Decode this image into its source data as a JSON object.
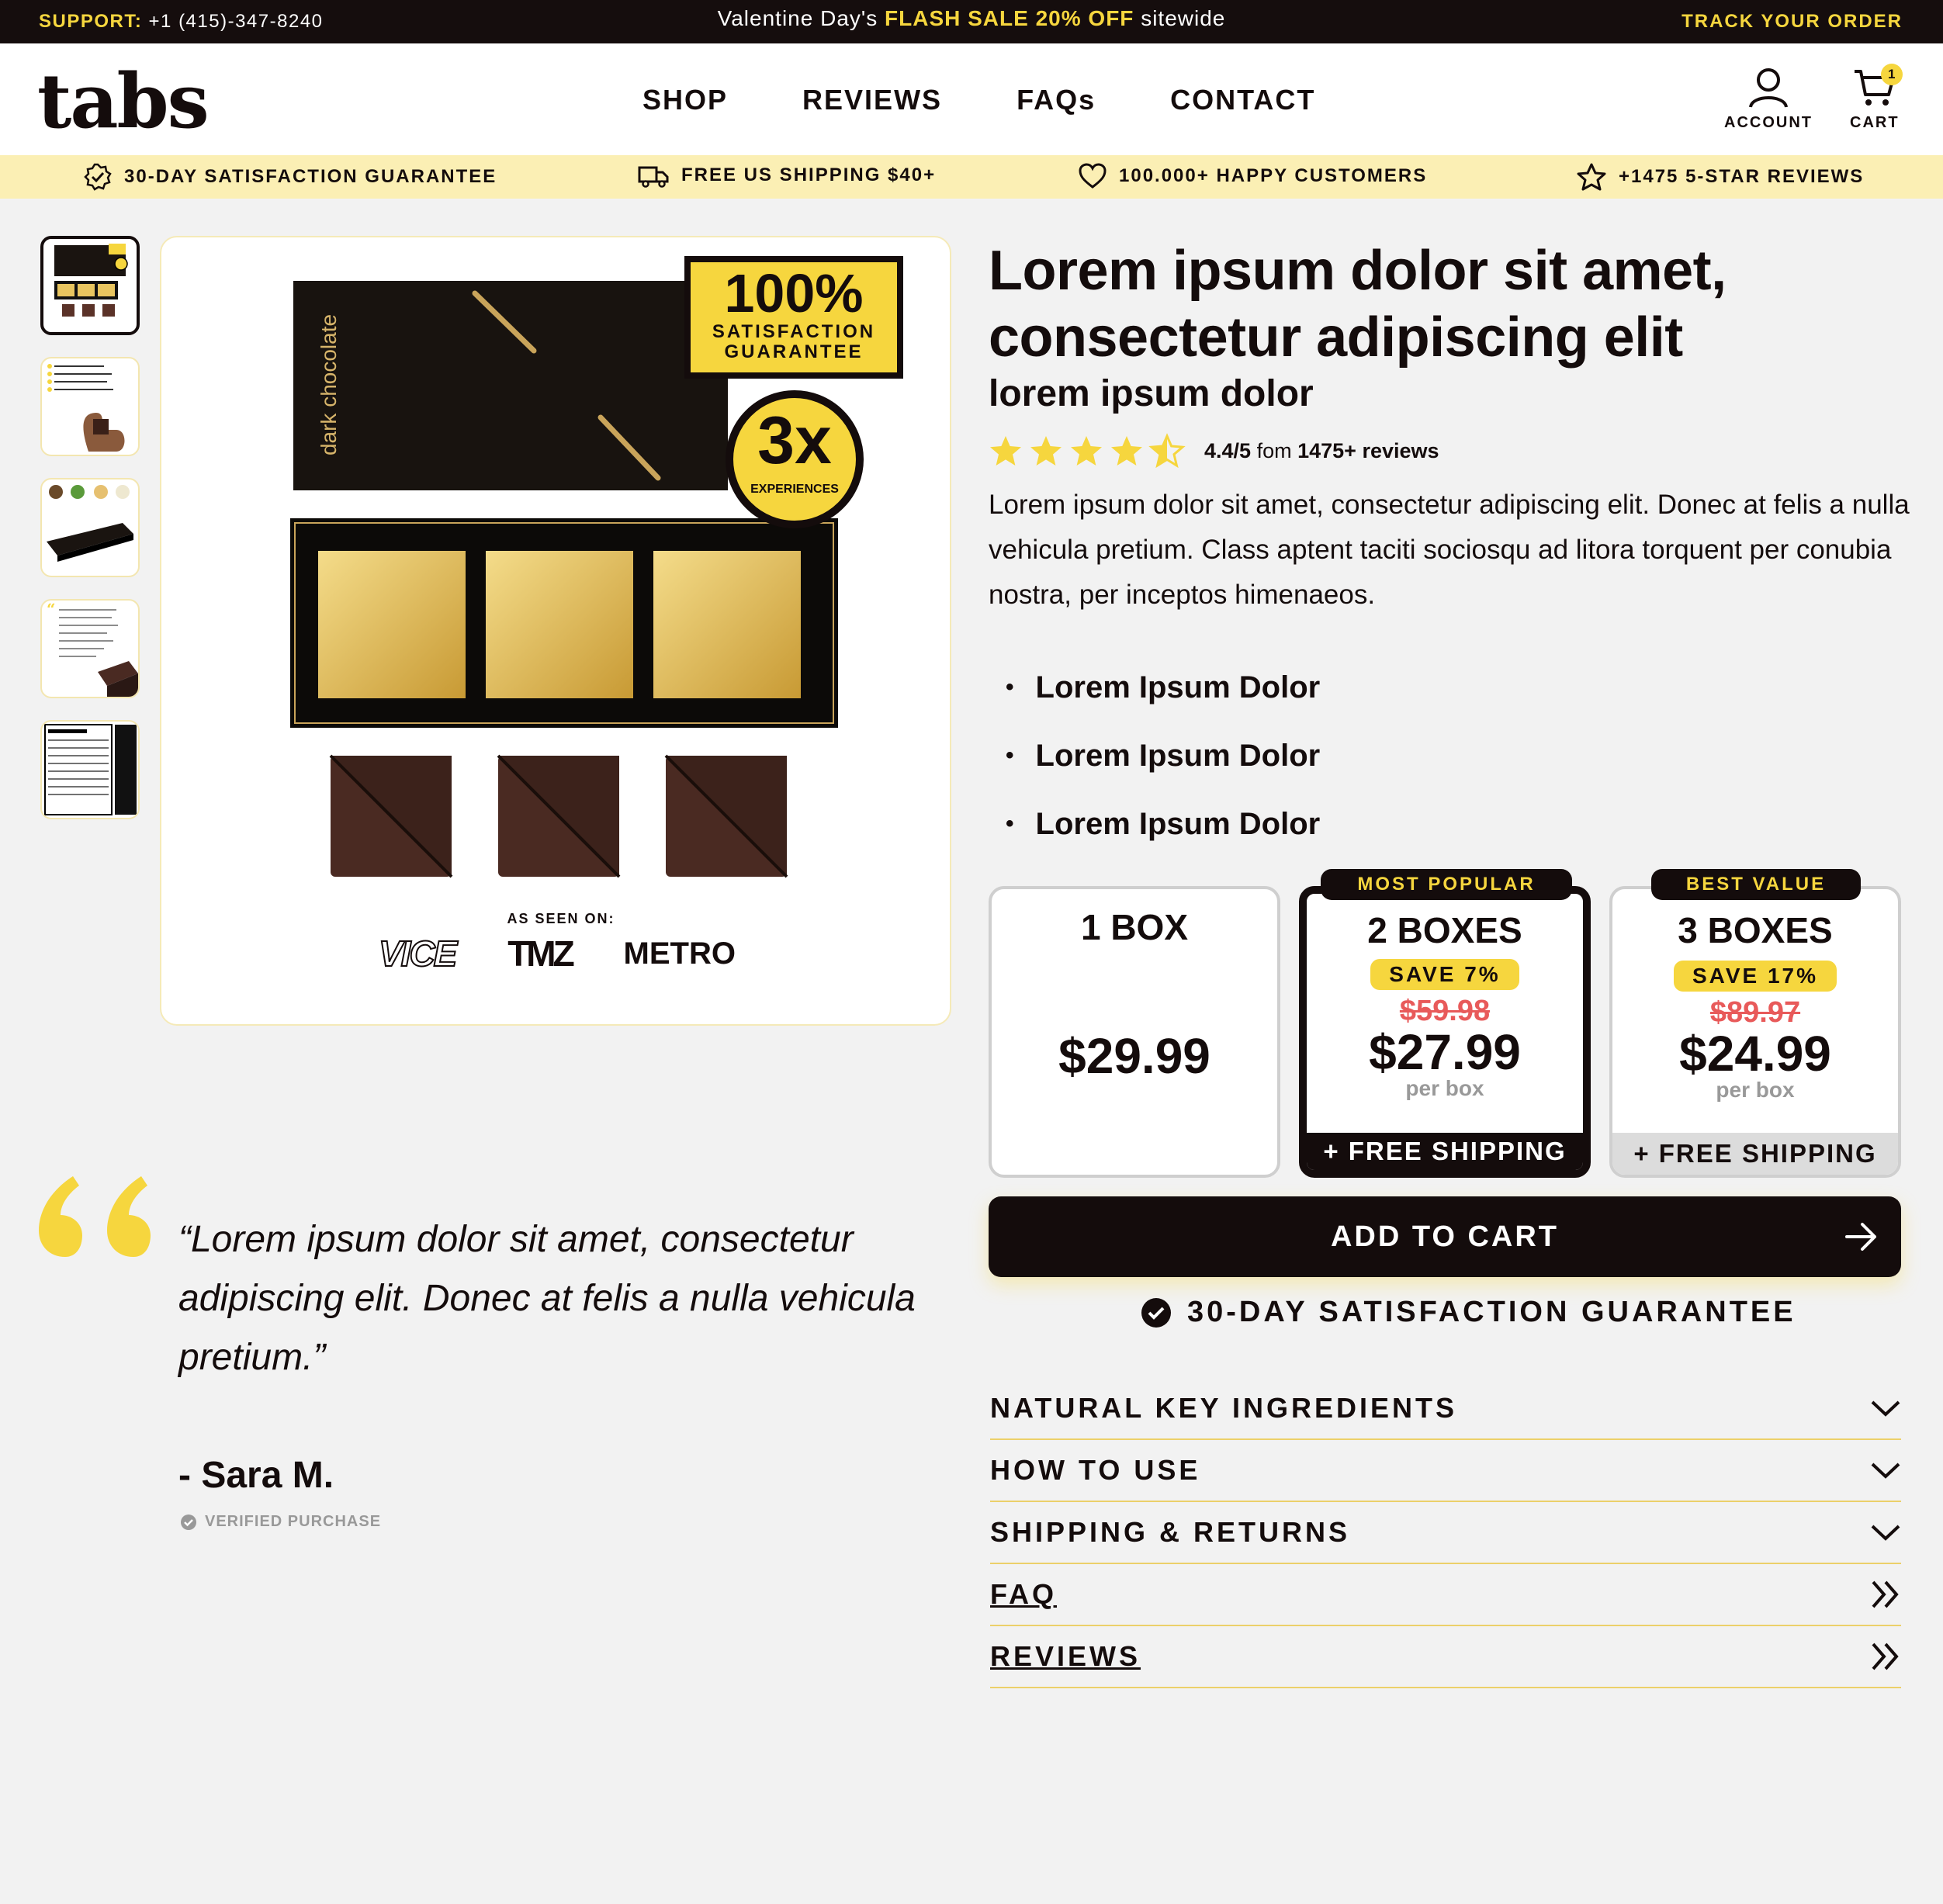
{
  "topbar": {
    "support_label": "SUPPORT:",
    "support_phone": "+1 (415)-347-8240",
    "promo_prefix": "Valentine Day's",
    "promo_highlight": "FLASH SALE 20% OFF",
    "promo_suffix": "sitewide",
    "track": "TRACK YOUR ORDER"
  },
  "header": {
    "logo": "tabs",
    "nav": [
      "SHOP",
      "REVIEWS",
      "FAQs",
      "CONTACT"
    ],
    "account_label": "ACCOUNT",
    "cart_label": "CART",
    "cart_count": "1"
  },
  "benefits": [
    {
      "icon": "badge-check-icon",
      "label": "30-DAY SATISFACTION GUARANTEE"
    },
    {
      "icon": "truck-icon",
      "label": "FREE US SHIPPING $40+"
    },
    {
      "icon": "heart-icon",
      "label": "100.000+ HAPPY CUSTOMERS"
    },
    {
      "icon": "star-outline-icon",
      "label": "+1475 5-STAR REVIEWS"
    }
  ],
  "gallery": {
    "thumbnails": [
      "product-box",
      "benefits-infographic",
      "ingredients",
      "customer-review",
      "nutrition-facts"
    ],
    "box_text": "dark chocolate",
    "badge_percent": "100%",
    "badge_line1": "SATISFACTION",
    "badge_line2": "GUARANTEE",
    "circle_big": "3x",
    "circle_small": "EXPERIENCES",
    "as_seen_on": "AS SEEN ON:",
    "press": [
      "VICE",
      "TMZ",
      "METRO"
    ]
  },
  "product": {
    "title": "Lorem ipsum dolor sit amet, consectetur adipiscing elit",
    "subtitle": "lorem ipsum dolor",
    "rating_value": 4.4,
    "rating_score": "4.4/5",
    "rating_from": "fom",
    "rating_count": "1475+ reviews",
    "description": "Lorem ipsum dolor sit amet, consectetur adipiscing elit. Donec at felis a nulla vehicula pretium. Class aptent taciti sociosqu ad litora torquent per conubia nostra, per inceptos himenaeos.",
    "bullets": [
      "Lorem Ipsum Dolor",
      "Lorem Ipsum Dolor",
      "Lorem Ipsum Dolor"
    ]
  },
  "pricing": [
    {
      "name": "1 BOX",
      "price": "$29.99"
    },
    {
      "tag": "MOST POPULAR",
      "name": "2 BOXES",
      "save": "SAVE 7%",
      "old": "$59.98",
      "price": "$27.99",
      "per": "per box",
      "ship": "+ FREE SHIPPING"
    },
    {
      "tag": "BEST VALUE",
      "name": "3 BOXES",
      "save": "SAVE 17%",
      "old": "$89.97",
      "price": "$24.99",
      "per": "per box",
      "ship": "+ FREE SHIPPING"
    }
  ],
  "cta": {
    "add_to_cart": "ADD TO CART",
    "guarantee": "30-DAY SATISFACTION GUARANTEE"
  },
  "accordion": [
    {
      "label": "NATURAL KEY INGREDIENTS",
      "icon": "chevron-down-icon"
    },
    {
      "label": "HOW TO USE",
      "icon": "chevron-down-icon"
    },
    {
      "label": "SHIPPING & RETURNS",
      "icon": "chevron-down-icon"
    },
    {
      "label": "FAQ",
      "icon": "double-chevron-right-icon"
    },
    {
      "label": "REVIEWS",
      "icon": "double-chevron-right-icon"
    }
  ],
  "testimonial": {
    "quote": "“Lorem ipsum dolor sit amet, consectetur adipiscing elit. Donec at felis a nulla vehicula pretium.”",
    "author": "- Sara M.",
    "verified": "VERIFIED PURCHASE"
  },
  "colors": {
    "accent": "#f6d63e",
    "dark": "#140c0c",
    "benefit_bar": "#fbefb4",
    "strike": "#e85a5a",
    "background": "#f2f2f2"
  }
}
